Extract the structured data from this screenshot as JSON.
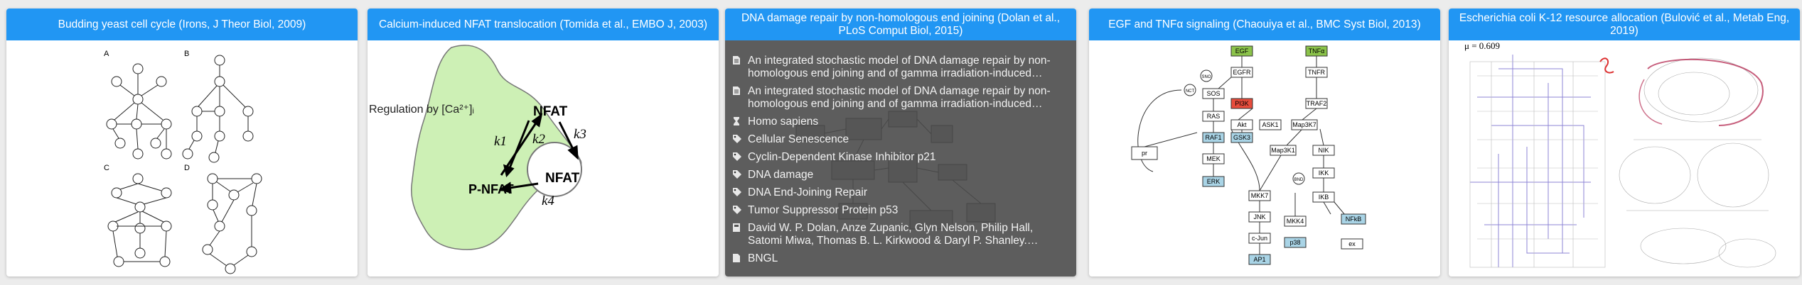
{
  "cards": [
    {
      "title": "Budding yeast cell cycle (Irons, J Theor Biol, 2009)",
      "panel_labels": [
        "A",
        "B",
        "C",
        "D"
      ]
    },
    {
      "title": "Calcium-induced NFAT translocation (Tomida et al., EMBO J, 2003)",
      "figure": {
        "regulation": "Regulation by [Ca²⁺]ᵢ",
        "nfat_top": "NFAT",
        "nfat_nucleus": "NFAT",
        "p_nfat": "P-NFAT",
        "k1": "k1",
        "k2": "k2",
        "k3": "k3",
        "k4": "k4"
      }
    },
    {
      "title": "DNA damage repair by non-homologous end joining (Dolan et al., PLoS Comput Biol, 2015)",
      "hover_items": [
        {
          "icon": "document-icon",
          "text": "An integrated stochastic model of DNA damage repair by non-homologous end joining and of gamma irradiation-induced cellular senescence"
        },
        {
          "icon": "document-icon",
          "text": "An integrated stochastic model of DNA damage repair by non-homologous end joining and of gamma irradiation-induced cellular senescence"
        },
        {
          "icon": "hourglass-icon",
          "text": "Homo sapiens"
        },
        {
          "icon": "tag-icon",
          "text": "Cellular Senescence"
        },
        {
          "icon": "tag-icon",
          "text": "Cyclin-Dependent Kinase Inhibitor p21"
        },
        {
          "icon": "tag-icon",
          "text": "DNA damage"
        },
        {
          "icon": "tag-icon",
          "text": "DNA End-Joining Repair"
        },
        {
          "icon": "tag-icon",
          "text": "Tumor Suppressor Protein p53"
        },
        {
          "icon": "author-icon",
          "text": "David W. P. Dolan, Anze Zupanic, Glyn Nelson, Philip Hall, Satomi Miwa, Thomas B. L. Kirkwood & Daryl P. Shanley. Integrated stochastic model"
        },
        {
          "icon": "file-icon",
          "text": "BNGL"
        }
      ]
    },
    {
      "title": "EGF and TNFα signaling (Chaouiya et al., BMC Syst Biol, 2013)",
      "nodes": {
        "egf": "EGF",
        "tnfa": "TNFα",
        "egfr": "EGFR",
        "tnfr": "TNFR",
        "sos": "SOS",
        "nik_top": "NCT",
        "ras": "RAS",
        "pi3k": "PI3K",
        "traf2": "TRAF2",
        "akt": "Akt",
        "ask1": "ASK1",
        "map3k7": "Map3K7",
        "gsk3": "GSK3",
        "raf1": "RAF1",
        "mek": "MEK",
        "map3k1": "Map3K1",
        "nik": "NIK",
        "erk": "ERK",
        "ikk": "IKK",
        "mkk7": "MKK7",
        "ikb": "IKB",
        "jnk": "JNK",
        "mkk4": "MKK4",
        "nfkb": "NFkB",
        "cjun": "c-Jun",
        "p38": "p38",
        "ap1": "AP1",
        "ex": "ex",
        "pr": "pr",
        "sno": "SNO",
        "bnd": "BND"
      }
    },
    {
      "title": "Escherichia coli K-12 resource allocation (Bulović et al., Metab Eng, 2019)",
      "mu_label": "μ = 0.609"
    }
  ],
  "colors": {
    "header": "#2196f3",
    "egf_node": "#8bc34a",
    "pi3k_node": "#e74c3c",
    "blue_node": "#a9d4e6"
  }
}
